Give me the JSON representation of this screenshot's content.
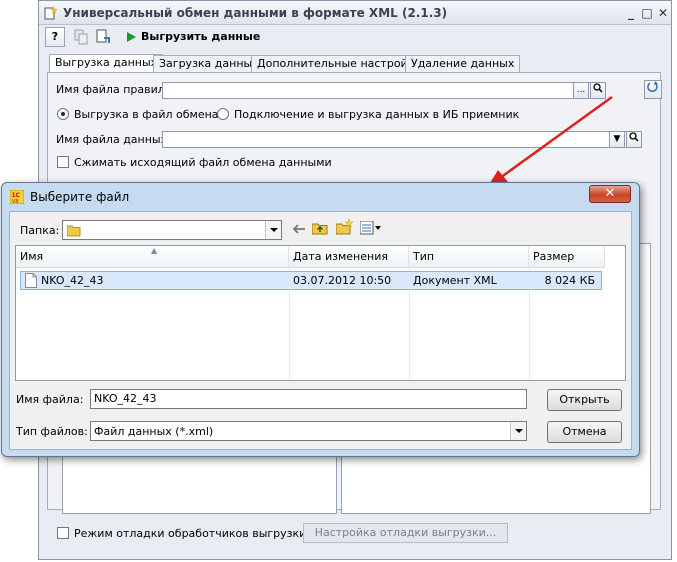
{
  "main_window": {
    "title": "Универсальный обмен данными в формате XML (2.1.3)",
    "controls": {
      "minimize": "_",
      "maximize": "□",
      "close": "✕"
    },
    "toolbar": {
      "help_label": "?",
      "export_label": "Выгрузить данные"
    },
    "tabs": [
      {
        "label": "Выгрузка данных"
      },
      {
        "label": "Загрузка данных"
      },
      {
        "label": "Дополнительные настройки"
      },
      {
        "label": "Удаление данных"
      }
    ],
    "rules_file_label": "Имя файла правил:",
    "export_to_file_label": "Выгрузка в файл обмена",
    "connect_and_export_label": "Подключение и выгрузка данных в ИБ приемник",
    "data_file_label": "Имя файла данных:",
    "compress_label": "Сжимать исходящий файл обмена данными",
    "debug_mode_label": "Режим отладки обработчиков выгрузки",
    "debug_settings_label": "Настройка отладки выгрузки..."
  },
  "file_dialog": {
    "title": "Выберите файл",
    "close_symbol": "✕",
    "folder_label": "Папка:",
    "columns": {
      "name": "Имя",
      "date": "Дата изменения",
      "type": "Тип",
      "size": "Размер"
    },
    "files": [
      {
        "name": "NKO_42_43",
        "date": "03.07.2012 10:50",
        "type": "Документ XML",
        "size": "8 024 КБ"
      }
    ],
    "file_name_label": "Имя файла:",
    "file_name_value": "NKO_42_43",
    "file_type_label": "Тип файлов:",
    "file_type_value": "Файл данных (*.xml)",
    "open_label": "Открыть",
    "cancel_label": "Отмена"
  },
  "colors": {
    "arrow": "#e02020",
    "selection": "#d9e9fb",
    "dialog_frame": "#c7dbf0"
  }
}
